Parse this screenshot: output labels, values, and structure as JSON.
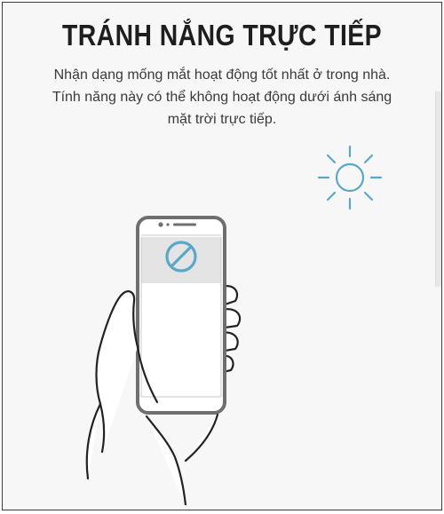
{
  "screen": {
    "title": "TRÁNH NẮNG TRỰC TIẾP",
    "description_lines": [
      "Nhận dạng mống mắt hoạt động tốt nhất ở trong nhà.",
      "Tính năng này có thể không hoạt động dưới ánh sáng",
      "mặt trời trực tiếp."
    ]
  },
  "icons": {
    "sun": "sun-icon",
    "blocked": "no-entry-icon",
    "phone": "phone-in-hand-illustration"
  },
  "colors": {
    "background": "#f7f7f7",
    "title_text": "#1e1e1e",
    "body_text": "#3a3a3a",
    "accent": "#5aa8c8",
    "phone_frame": "#6f6f6f",
    "phone_screen_top": "#e4e4e4",
    "line_art": "#222222"
  }
}
